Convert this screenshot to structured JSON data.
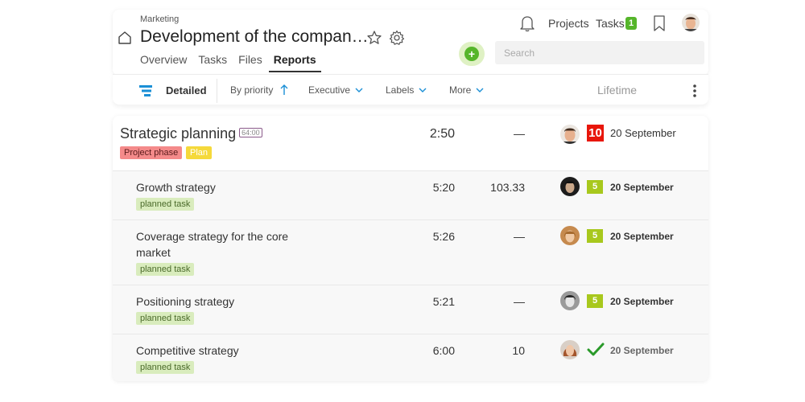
{
  "header": {
    "breadcrumb": "Marketing",
    "title": "Development of the compan…",
    "tabs": [
      {
        "label": "Overview",
        "active": false
      },
      {
        "label": "Tasks",
        "active": false
      },
      {
        "label": "Files",
        "active": false
      },
      {
        "label": "Reports",
        "active": true
      }
    ],
    "search_placeholder": "Search",
    "projects_label": "Projects",
    "tasks_label": "Tasks",
    "tasks_count": "1"
  },
  "toolbar": {
    "view": "Detailed",
    "sort": "By priority",
    "executive": "Executive",
    "labels": "Labels",
    "more": "More",
    "period": "Lifetime"
  },
  "rows": [
    {
      "name": "Strategic planning",
      "estimate": "64:00",
      "tags": [
        "Project phase",
        "Plan"
      ],
      "time": "2:50",
      "value": "—",
      "priority": "10",
      "date": "20 September"
    },
    {
      "name": "Growth strategy",
      "tag": "planned task",
      "time": "5:20",
      "value": "103.33",
      "priority": "5",
      "date": "20 September"
    },
    {
      "name_line1": "Coverage strategy for the core",
      "name_line2": "market",
      "tag": "planned task",
      "time": "5:26",
      "value": "—",
      "priority": "5",
      "date": "20 September"
    },
    {
      "name": "Positioning strategy",
      "tag": "planned task",
      "time": "5:21",
      "value": "—",
      "priority": "5",
      "date": "20 September"
    },
    {
      "name": "Competitive strategy",
      "tag": "planned task",
      "time": "6:00",
      "value": "10",
      "status": "done",
      "date": "20 September"
    }
  ],
  "colors": {
    "accent_green": "#55b52a",
    "priority_green": "#a8c81d",
    "priority_red": "#e8160b",
    "tag_planned": "#d9ecbd",
    "tag_phase": "#f48a8a",
    "tag_plan": "#f5d93b"
  }
}
